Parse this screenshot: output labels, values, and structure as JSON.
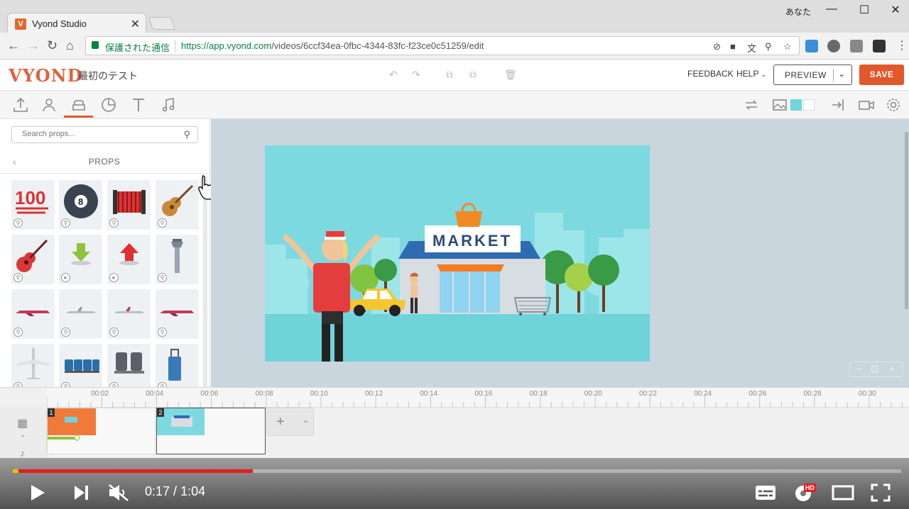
{
  "browser": {
    "tab_title": "Vyond Studio",
    "favicon_letter": "V",
    "user_name": "あなた",
    "security_label": "保護された通信",
    "url_host": "https://app.vyond.com",
    "url_path": "/videos/6ccf34ea-0fbc-4344-83fc-f23ce0c51259/edit"
  },
  "app": {
    "logo": "VYOND",
    "project_name": "最初のテスト",
    "feedback_label": "FEEDBACK",
    "help_label": "HELP",
    "preview_label": "PREVIEW",
    "save_label": "SAVE",
    "brand_color": "#e0582c"
  },
  "left_panel": {
    "search_placeholder": "Search props...",
    "section_title": "PROPS",
    "props": [
      "100-emoji",
      "8-ball",
      "accordion",
      "acoustic-guitar",
      "red-guitar",
      "green-down-arrow",
      "red-up-arrow",
      "control-tower",
      "airplane-side-1",
      "airplane-side-2",
      "airplane-side-3",
      "airplane-side-4",
      "airplane-top",
      "blue-seats",
      "grey-seats",
      "luggage-trolley"
    ]
  },
  "stage": {
    "sign_text": "MARKET",
    "background_color": "#7dd9e0"
  },
  "timeline": {
    "ticks": [
      "00:02",
      "00:04",
      "00:06",
      "00:08",
      "00:10",
      "00:12",
      "00:14",
      "00:16",
      "00:18",
      "00:20",
      "00:22",
      "00:24",
      "00:26",
      "00:28",
      "00:30"
    ],
    "scenes": [
      "1",
      "2"
    ]
  },
  "player": {
    "time_current": "0:17",
    "time_total": "1:04",
    "progress_fraction": 0.27,
    "hd_badge": "HD"
  }
}
